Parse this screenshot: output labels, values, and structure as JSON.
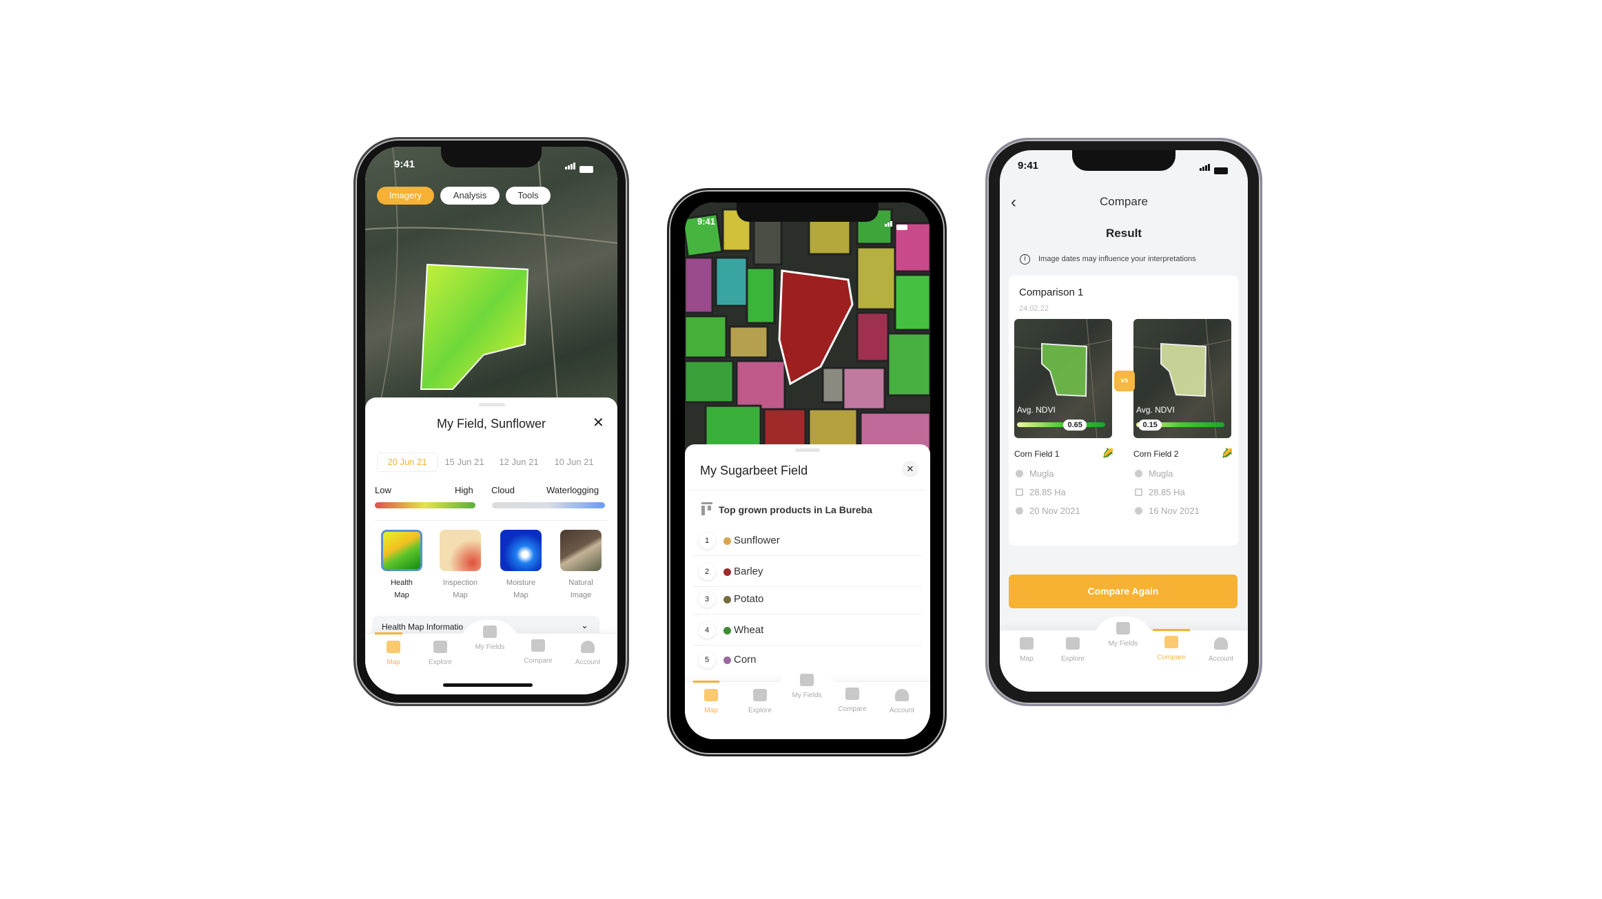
{
  "status_time": "9:41",
  "nav": {
    "items": [
      "Map",
      "Explore",
      "My Fields",
      "Compare",
      "Account"
    ]
  },
  "phone1": {
    "tabs": [
      "Imagery",
      "Analysis",
      "Tools"
    ],
    "title": "My Field, Sunflower",
    "dates": [
      "20 Jun 21",
      "15 Jun 21",
      "12 Jun 21",
      "10 Jun 21"
    ],
    "legend": {
      "low": "Low",
      "high": "High",
      "cloud": "Cloud",
      "waterlogging": "Waterlogging"
    },
    "layers": [
      {
        "l1": "Health",
        "l2": "Map"
      },
      {
        "l1": "Inspection",
        "l2": "Map"
      },
      {
        "l1": "Moisture",
        "l2": "Map"
      },
      {
        "l1": "Natural",
        "l2": "Image"
      }
    ],
    "info_label": "Health Map Informatio",
    "accent": "#F7B133"
  },
  "phone2": {
    "title": "My Sugarbeet Field",
    "list_header": "Top grown products in La Bureba",
    "products": [
      {
        "rank": "1",
        "name": "Sunflower",
        "color": "#D9A54E"
      },
      {
        "rank": "2",
        "name": "Barley",
        "color": "#9E2A2B"
      },
      {
        "rank": "3",
        "name": "Potato",
        "color": "#786A43"
      },
      {
        "rank": "4",
        "name": "Wheat",
        "color": "#3E8A35"
      },
      {
        "rank": "5",
        "name": "Corn",
        "color": "#9B6A9B"
      }
    ]
  },
  "phone3": {
    "title": "Compare",
    "subtitle": "Result",
    "notice": "Image dates may influence your interpretations",
    "comparison_title": "Comparison 1",
    "comparison_date": "24.02.22",
    "vs": "vs",
    "ndvi_label": "Avg. NDVI",
    "fields": [
      {
        "name": "Corn Field 1",
        "ndvi": "0.65",
        "ndvi_value": 0.65,
        "location": "Mugla",
        "area": "28.85 Ha",
        "date": "20 Nov 2021"
      },
      {
        "name": "Corn Field 2",
        "ndvi": "0.15",
        "ndvi_value": 0.15,
        "location": "Mugla",
        "area": "28.85 Ha",
        "date": "16 Nov 2021"
      }
    ],
    "button": "Compare Again"
  }
}
